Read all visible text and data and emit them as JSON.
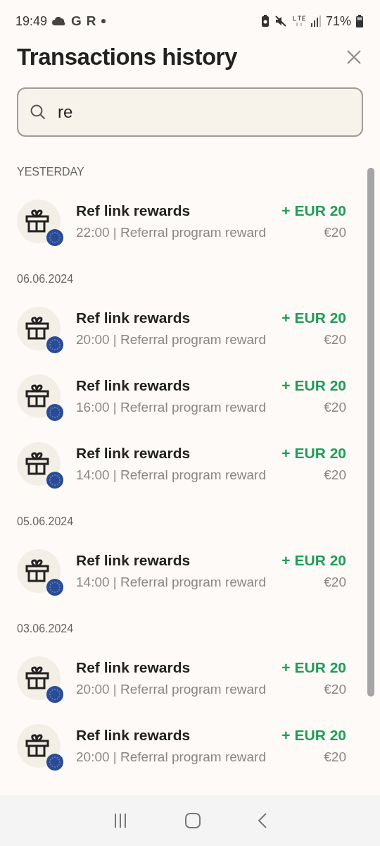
{
  "status_bar": {
    "time": "19:49",
    "notification_letters": [
      "G",
      "R"
    ],
    "battery": "71%"
  },
  "header": {
    "title": "Transactions history"
  },
  "search": {
    "value": "re"
  },
  "separator": "|",
  "groups": [
    {
      "date": "YESTERDAY",
      "transactions": [
        {
          "title": "Ref link rewards",
          "time": "22:00",
          "description": "Referral program reward",
          "amount": "+ EUR 20",
          "fiat": "€20"
        }
      ]
    },
    {
      "date": "06.06.2024",
      "transactions": [
        {
          "title": "Ref link rewards",
          "time": "20:00",
          "description": "Referral program reward",
          "amount": "+ EUR 20",
          "fiat": "€20"
        },
        {
          "title": "Ref link rewards",
          "time": "16:00",
          "description": "Referral program reward",
          "amount": "+ EUR 20",
          "fiat": "€20"
        },
        {
          "title": "Ref link rewards",
          "time": "14:00",
          "description": "Referral program reward",
          "amount": "+ EUR 20",
          "fiat": "€20"
        }
      ]
    },
    {
      "date": "05.06.2024",
      "transactions": [
        {
          "title": "Ref link rewards",
          "time": "14:00",
          "description": "Referral program reward",
          "amount": "+ EUR 20",
          "fiat": "€20"
        }
      ]
    },
    {
      "date": "03.06.2024",
      "transactions": [
        {
          "title": "Ref link rewards",
          "time": "20:00",
          "description": "Referral program reward",
          "amount": "+ EUR 20",
          "fiat": "€20"
        },
        {
          "title": "Ref link rewards",
          "time": "20:00",
          "description": "Referral program reward",
          "amount": "+ EUR 20",
          "fiat": "€20"
        }
      ]
    }
  ]
}
